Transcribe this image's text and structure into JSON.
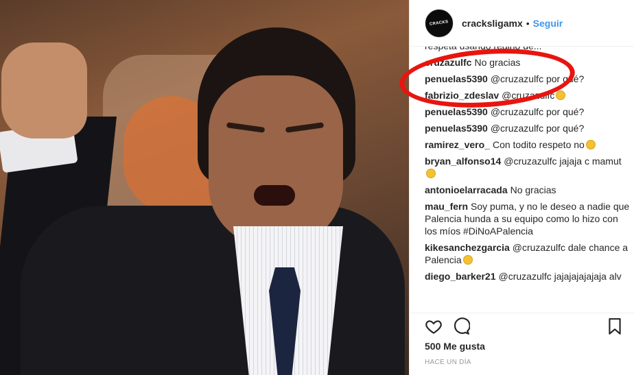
{
  "post": {
    "username": "cracksligamx",
    "separator": "•",
    "follow_label": "Seguir",
    "avatar_text": "CRACKS"
  },
  "comments": [
    {
      "user": "",
      "text": "respeta usando regino de..."
    },
    {
      "user": "cruzazulfc",
      "text": "No gracias"
    },
    {
      "user": "penuelas5390",
      "text": "@cruzazulfc por qué?"
    },
    {
      "user": "fabrizio_zdeslav",
      "text": "@cruzazulfc",
      "emoji": "laughing-emoji"
    },
    {
      "user": "penuelas5390",
      "text": "@cruzazulfc por qué?"
    },
    {
      "user": "penuelas5390",
      "text": "@cruzazulfc por qué?"
    },
    {
      "user": "ramirez_vero_",
      "text": "Con todito respeto no",
      "emoji": "grimacing-emoji"
    },
    {
      "user": "bryan_alfonso14",
      "text": "@cruzazulfc jajaja c mamut",
      "emoji": "laughing-emoji"
    },
    {
      "user": "antonioelarracada",
      "text": "No gracias"
    },
    {
      "user": "mau_fern",
      "text": "Soy puma, y no le deseo a nadie que Palencia hunda a su equipo como lo hizo con los míos #DiNoAPalencia"
    },
    {
      "user": "kikesanchezgarcia",
      "text": "@cruzazulfc dale chance a Palencia",
      "emoji": "laughing-emoji"
    },
    {
      "user": "diego_barker21",
      "text": "@cruzazulfc jajajajajajaja alv"
    }
  ],
  "footer": {
    "likes": "500 Me gusta",
    "time": "HACE UN DÍA"
  },
  "colors": {
    "accent": "#3897f0",
    "annotation": "#e8150f",
    "text": "#262626"
  },
  "icons": {
    "like": "heart-icon",
    "comment": "comment-icon",
    "save": "bookmark-icon"
  }
}
